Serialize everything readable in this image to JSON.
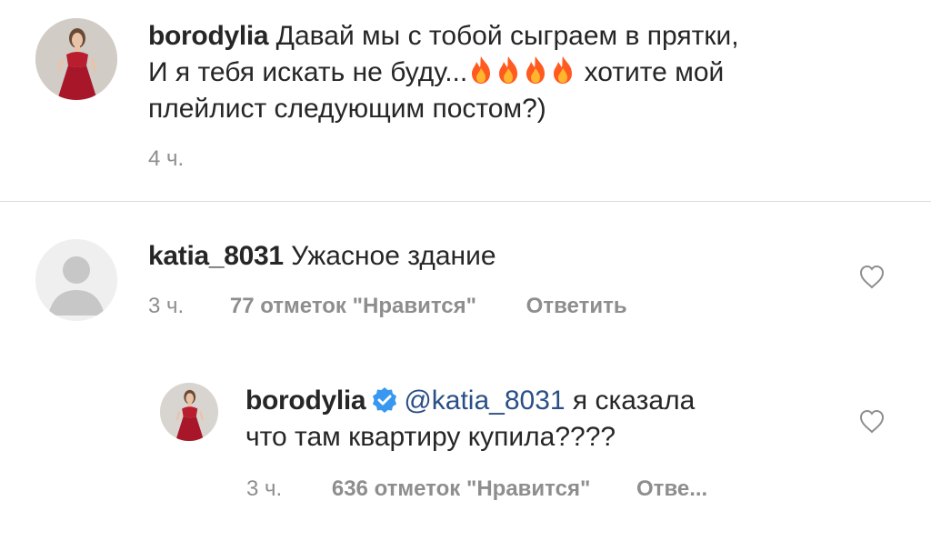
{
  "comments": [
    {
      "username": "borodylia",
      "text_line1": "Давай мы с тобой сыграем в прятки,",
      "text_line2_pre": "И я тебя искать не буду...",
      "emoji": [
        "fire",
        "fire",
        "fire",
        "fire"
      ],
      "text_line2_post": "хотите мой",
      "text_line3": "плейлист следующим постом?)",
      "time": "4 ч."
    },
    {
      "username": "katia_8031",
      "text": "Ужасное здание",
      "time": "3 ч.",
      "likes": "77 отметок \"Нравится\"",
      "reply": "Ответить"
    }
  ],
  "reply": {
    "username": "borodylia",
    "verified": true,
    "mention": "@katia_8031",
    "text_line1": "я сказала",
    "text_line2": "что там квартиру купила????",
    "time": "3 ч.",
    "likes": "636 отметок \"Нравится\"",
    "reply_truncated": "Отве..."
  },
  "colors": {
    "text": "#262626",
    "meta": "#8e8e8e",
    "mention": "#2a4f86",
    "verified": "#3897f0",
    "fire": "#ff5a1f"
  }
}
